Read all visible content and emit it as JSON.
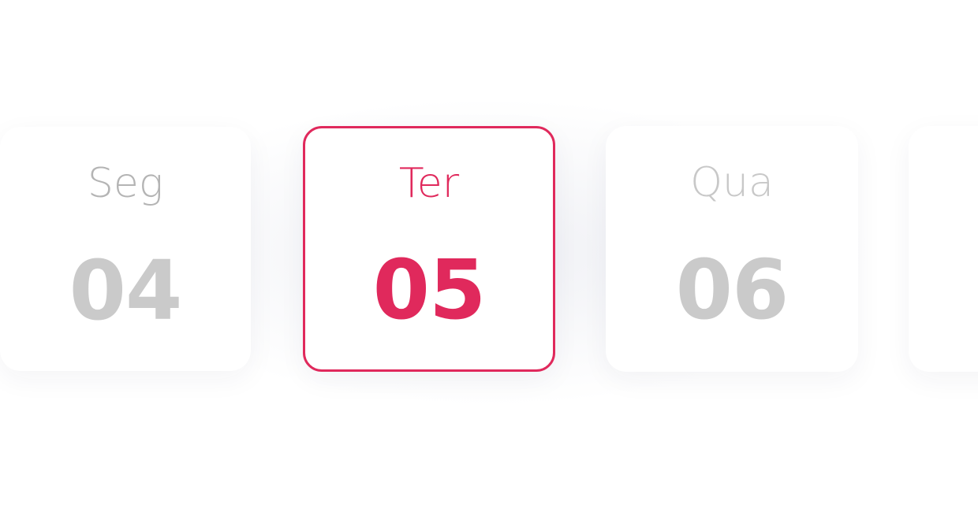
{
  "colors": {
    "accent": "#e0295c",
    "inactive_label": "#b4b4b4",
    "inactive_number": "#cacaca"
  },
  "days": [
    {
      "label": "Seg",
      "number": "04",
      "selected": false
    },
    {
      "label": "Ter",
      "number": "05",
      "selected": true
    },
    {
      "label": "Qua",
      "number": "06",
      "selected": false
    }
  ]
}
